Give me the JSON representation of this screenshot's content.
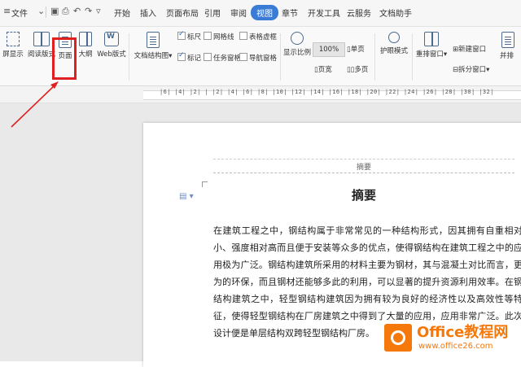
{
  "menubar": {
    "items": [
      "文件",
      "开始",
      "插入",
      "页面布局",
      "引用",
      "审阅",
      "视图",
      "章节",
      "开发工具",
      "云服务",
      "文档助手"
    ],
    "active": "视图"
  },
  "ribbon": {
    "full_screen": "屏显示",
    "read_mode": "阅读版式",
    "page_view": "页面",
    "outline": "大纲",
    "web_layout": "Web版式",
    "doc_structure": "文档结构图",
    "ruler": "标尺",
    "gridlines": "网格线",
    "table_grid": "表格虚框",
    "marks": "标记",
    "task_pane": "任务窗格",
    "nav_pane": "导航窗格",
    "zoom": "显示比例",
    "zoom_100": "100%",
    "page_width": "页宽",
    "single_page": "单页",
    "multi_page": "多页",
    "eye_mode": "护眼模式",
    "arrange": "重排窗口",
    "new_window": "新建窗口",
    "split_window": "拆分窗口",
    "side_by_side": "并排"
  },
  "ruler": {
    "text": "|6|  |4|  |2|  |  |2|  |4|  |6|  |8|  |10|  |12|  |14|  |16|  |18|  |20|  |22|  |24|  |26|  |28|  |30|  |32|"
  },
  "document": {
    "header": "摘要",
    "title": "摘要",
    "body": "在建筑工程之中，钢结构属于非常常见的一种结构形式，因其拥有自重相对小、强度相对高而且便于安装等众多的优点，使得钢结构在建筑工程之中的应用极为广泛。钢结构建筑所采用的材料主要为钢材，其与混凝土对比而言，更为的环保，而且钢材还能够多此的利用，可以显著的提升资源利用效率。在钢结构建筑之中，轻型钢结构建筑因为拥有较为良好的经济性以及高效性等特征，使得轻型钢结构在厂房建筑之中得到了大量的应用，应用非常广泛。此次设计便是单层结构双跨轻型钢结构厂房。"
  },
  "watermark": {
    "brand": "Office教程网",
    "url": "www.office26.com"
  },
  "colors": {
    "accent": "#3a7bd5",
    "highlight": "#e02020",
    "logo": "#f4780a"
  }
}
